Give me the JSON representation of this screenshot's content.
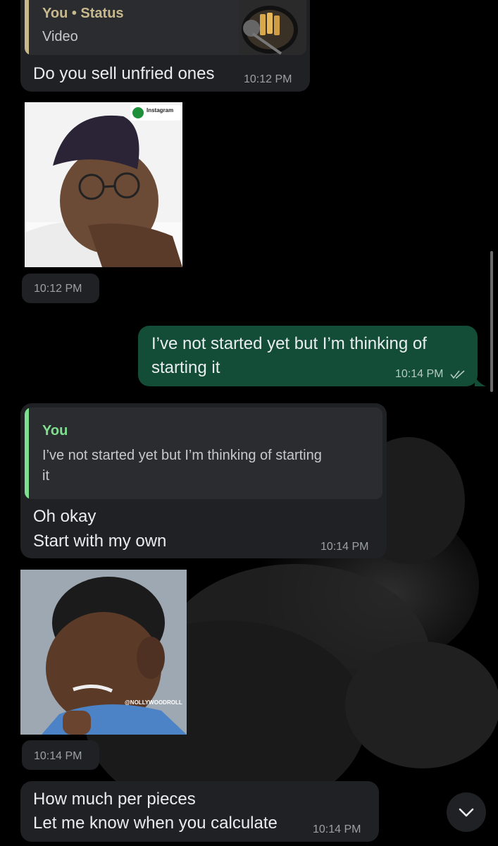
{
  "messages": {
    "m1": {
      "quote_author": "You • Status",
      "quote_text": "Video",
      "text": "Do you sell unfried ones",
      "time": "10:12 PM"
    },
    "m2": {
      "time": "10:12 PM",
      "sticker_caption": "Instagram"
    },
    "m3": {
      "line1": "I’ve not started yet but I’m thinking of",
      "line2": "starting it",
      "time": "10:14 PM"
    },
    "m4": {
      "quote_author": "You",
      "quote_line1": "I’ve not started yet but I’m thinking of starting",
      "quote_line2": "it",
      "line1": "Oh okay",
      "line2": "Start with my own",
      "time": "10:14 PM"
    },
    "m5": {
      "time": "10:14 PM",
      "watermark": "@NOLLYWOODROLL"
    },
    "m6": {
      "line1": "How much per pieces",
      "line2": "Let me know when you calculate",
      "time": "10:14 PM"
    }
  },
  "colors": {
    "incoming": "#202124",
    "outgoing": "#134d37",
    "quote_status": "#c8b98d",
    "quote_you": "#7ee08f",
    "background": "#000000"
  },
  "icons": {
    "scroll_down": "chevron-down-icon",
    "read_receipt": "double-check-icon"
  }
}
